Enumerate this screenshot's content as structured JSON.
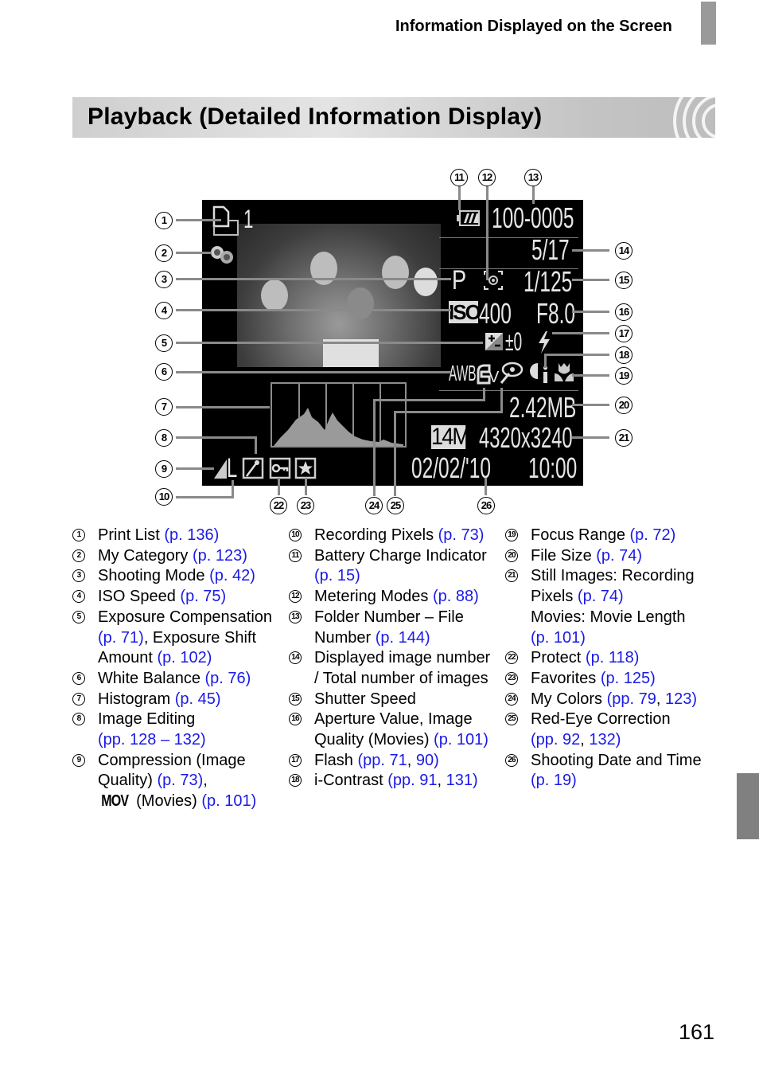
{
  "header": {
    "section": "Information Displayed on the Screen"
  },
  "title": "Playback (Detailed Information Display)",
  "screen": {
    "print_count": "1",
    "folder_file": "100-0005",
    "image_index": "5/17",
    "shooting_mode": "P",
    "shutter_speed": "1/125",
    "iso_label": "ISO",
    "iso_value": "400",
    "aperture": "F8.0",
    "exposure_comp": "±0",
    "white_balance": "AWB",
    "my_colors": "V",
    "file_size": "2.42MB",
    "recording_pixels_badge": "14M",
    "resolution": "4320x3240",
    "date": "02/02/'10",
    "time": "10:00",
    "compression": "L",
    "icons": [
      "print-list-icon",
      "my-category-icon",
      "battery-icon",
      "metering-icon",
      "iso-icon",
      "exposure-comp-icon",
      "flash-icon",
      "white-balance-icon",
      "my-colors-icon",
      "red-eye-icon",
      "i-contrast-icon",
      "macro-icon",
      "compression-icon",
      "image-edit-icon",
      "protect-icon",
      "favorite-icon"
    ]
  },
  "callouts": [
    "1",
    "2",
    "3",
    "4",
    "5",
    "6",
    "7",
    "8",
    "9",
    "10",
    "11",
    "12",
    "13",
    "14",
    "15",
    "16",
    "17",
    "18",
    "19",
    "20",
    "21",
    "22",
    "23",
    "24",
    "25",
    "26"
  ],
  "legend": {
    "col1": [
      {
        "n": "1",
        "text": "Print List ",
        "link": "(p. 136)"
      },
      {
        "n": "2",
        "text": "My Category ",
        "link": "(p. 123)"
      },
      {
        "n": "3",
        "text": "Shooting Mode ",
        "link": "(p. 42)"
      },
      {
        "n": "4",
        "text": "ISO Speed ",
        "link": "(p. 75)"
      },
      {
        "n": "5",
        "text": "Exposure Compensation",
        "link": "",
        "l2link": "(p. 71)",
        "l2text": ", Exposure Shift",
        "l3text": "Amount ",
        "l3link": "(p. 102)"
      },
      {
        "n": "6",
        "text": "White Balance ",
        "link": "(p. 76)"
      },
      {
        "n": "7",
        "text": "Histogram ",
        "link": "(p. 45)"
      },
      {
        "n": "8",
        "text": "Image Editing",
        "link": "",
        "l2link": "(pp. 128 – 132)"
      },
      {
        "n": "9",
        "text": "Compression (Image",
        "link": "",
        "l2text": "Quality) ",
        "l2link": "(p. 73)",
        "l2tail": ",",
        "l3glyph": "MOV",
        "l3text": " (Movies) ",
        "l3link": "(p. 101)"
      }
    ],
    "col2": [
      {
        "n": "10",
        "text": "Recording Pixels ",
        "link": "(p. 73)"
      },
      {
        "n": "11",
        "text": "Battery Charge Indicator",
        "link": "",
        "l2link": "(p. 15)"
      },
      {
        "n": "12",
        "text": "Metering Modes ",
        "link": "(p. 88)"
      },
      {
        "n": "13",
        "text": "Folder Number – File",
        "link": "",
        "l2text": "Number ",
        "l2link": "(p. 144)"
      },
      {
        "n": "14",
        "text": "Displayed image number",
        "link": "",
        "l2text": "/ Total number of images"
      },
      {
        "n": "15",
        "text": "Shutter Speed",
        "link": ""
      },
      {
        "n": "16",
        "text": "Aperture Value, Image",
        "link": "",
        "l2text": "Quality (Movies) ",
        "l2link": "(p. 101)"
      },
      {
        "n": "17",
        "text": "Flash ",
        "link": "(pp. 71",
        "sep": ", ",
        "link2": "90)"
      },
      {
        "n": "18",
        "text": "i-Contrast ",
        "link": "(pp. 91",
        "sep": ", ",
        "link2": "131)"
      }
    ],
    "col3": [
      {
        "n": "19",
        "text": "Focus Range ",
        "link": "(p. 72)"
      },
      {
        "n": "20",
        "text": "File Size ",
        "link": "(p. 74)"
      },
      {
        "n": "21",
        "text": "Still Images: Recording",
        "link": "",
        "l2text": "Pixels ",
        "l2link": "(p. 74)",
        "l3text": "Movies: Movie Length",
        "l4link": "(p. 101)"
      },
      {
        "n": "22",
        "text": "Protect ",
        "link": "(p. 118)"
      },
      {
        "n": "23",
        "text": "Favorites ",
        "link": "(p. 125)"
      },
      {
        "n": "24",
        "text": "My Colors ",
        "link": "(pp. 79",
        "sep": ", ",
        "link2": "123)"
      },
      {
        "n": "25",
        "text": "Red-Eye Correction",
        "link": "",
        "l2link": "(pp. 92",
        "l2sep": ", ",
        "l2link2": "132)"
      },
      {
        "n": "26",
        "text": "Shooting Date and Time",
        "link": "",
        "l2link": "(p. 19)"
      }
    ]
  },
  "page_number": "161",
  "colors": {
    "link": "#1a1ae6",
    "leader": "#8a8a8a",
    "tab": "#9a9a9a"
  }
}
